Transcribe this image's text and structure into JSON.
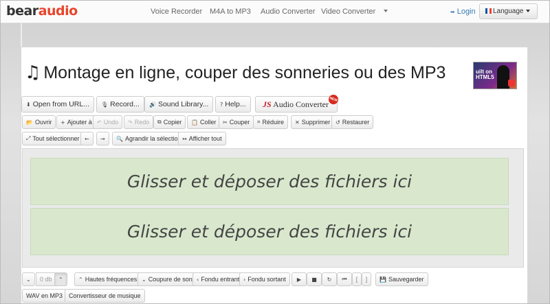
{
  "nav": {
    "logo_part1": "bear",
    "logo_part2": "audio",
    "links": [
      "Voice Recorder",
      "M4A to MP3",
      "Audio Converter",
      "Video Converter"
    ],
    "login": "Login",
    "language": "Language"
  },
  "page": {
    "title": "Montage en ligne, couper des sonneries ou des MP3",
    "thumbnail_text": "uilt on\nHTML5"
  },
  "actions": {
    "open_url": "Open from URL...",
    "record": "Record...",
    "sound_library": "Sound Library...",
    "help": "Help...",
    "js_prefix": "JS",
    "js_suffix": " Audio Converter",
    "new_badge": "NEW"
  },
  "toolbar": {
    "ouvrir": "Ouvrir",
    "ajouter": "Ajouter à",
    "undo": "Undo",
    "redo": "Redo",
    "copier": "Copier",
    "coller": "Coller",
    "couper": "Couper",
    "reduire": "Réduire",
    "supprimer": "Supprimer",
    "restaurer": "Restaurer",
    "tout_selectionner": "Tout sélectionner",
    "agrandir": "Agrandir la sélection",
    "afficher_tout": "Afficher tout"
  },
  "editor": {
    "drop_text_1": "Glisser et déposer des fichiers ici",
    "drop_text_2": "Glisser et déposer des fichiers ici"
  },
  "bottom": {
    "db_value": "0 db",
    "hautes": "Hautes fréquences",
    "coupure": "Coupure de son",
    "fondu_entrant": "Fondu entrant",
    "fondu_sortant": "Fondu sortant",
    "bracket_left": "[",
    "bracket_right": "]",
    "sauvegarder": "Sauvegarder",
    "wav_mp3": "WAV en MP3",
    "convertisseur": "Convertisseur de musique"
  }
}
